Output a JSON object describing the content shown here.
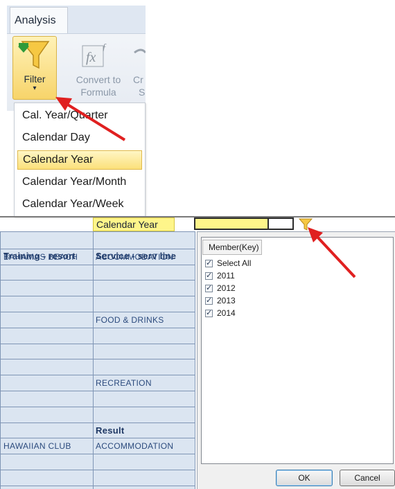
{
  "ribbon": {
    "tab_label": "Analysis",
    "filter_label": "Filter",
    "filter_caret": "▾",
    "convert_label_line1": "Convert to",
    "convert_label_line2": "Formula",
    "cr_label_line1": "Cr",
    "cr_label_line2": "S"
  },
  "dropdown": {
    "items": [
      {
        "label": "Cal. Year/Quarter",
        "selected": false
      },
      {
        "label": "Calendar Day",
        "selected": false
      },
      {
        "label": "Calendar Year",
        "selected": true
      },
      {
        "label": "Calendar Year/Month",
        "selected": false
      },
      {
        "label": "Calendar Year/Week",
        "selected": false
      }
    ]
  },
  "sheet": {
    "calendar_year_header": "Calendar Year",
    "col_a_header": "Training - resort",
    "col_b_header": "Service - serv line",
    "rows": [
      {
        "a": "BAHAMAS BEACH",
        "b": "ACCOMMODATION"
      },
      {
        "a": "",
        "b": ""
      },
      {
        "a": "",
        "b": ""
      },
      {
        "a": "",
        "b": ""
      },
      {
        "a": "",
        "b": "FOOD & DRINKS"
      },
      {
        "a": "",
        "b": ""
      },
      {
        "a": "",
        "b": ""
      },
      {
        "a": "",
        "b": ""
      },
      {
        "a": "",
        "b": "RECREATION"
      },
      {
        "a": "",
        "b": ""
      },
      {
        "a": "",
        "b": ""
      },
      {
        "a": "",
        "b": "Result"
      },
      {
        "a": "HAWAIIAN CLUB",
        "b": "ACCOMMODATION"
      },
      {
        "a": "",
        "b": ""
      },
      {
        "a": "",
        "b": ""
      }
    ]
  },
  "filter_dialog": {
    "column_header": "Member(Key)",
    "options": [
      {
        "label": "Select All",
        "checked": true
      },
      {
        "label": "2011",
        "checked": true
      },
      {
        "label": "2012",
        "checked": true
      },
      {
        "label": "2013",
        "checked": true
      },
      {
        "label": "2014",
        "checked": true
      }
    ],
    "ok_label": "OK",
    "cancel_label": "Cancel"
  },
  "colors": {
    "highlight_yellow": "#fef58a",
    "annotation_arrow": "#e02020",
    "grid_fill": "#dbe5f1",
    "grid_text": "#2b4a7d"
  }
}
